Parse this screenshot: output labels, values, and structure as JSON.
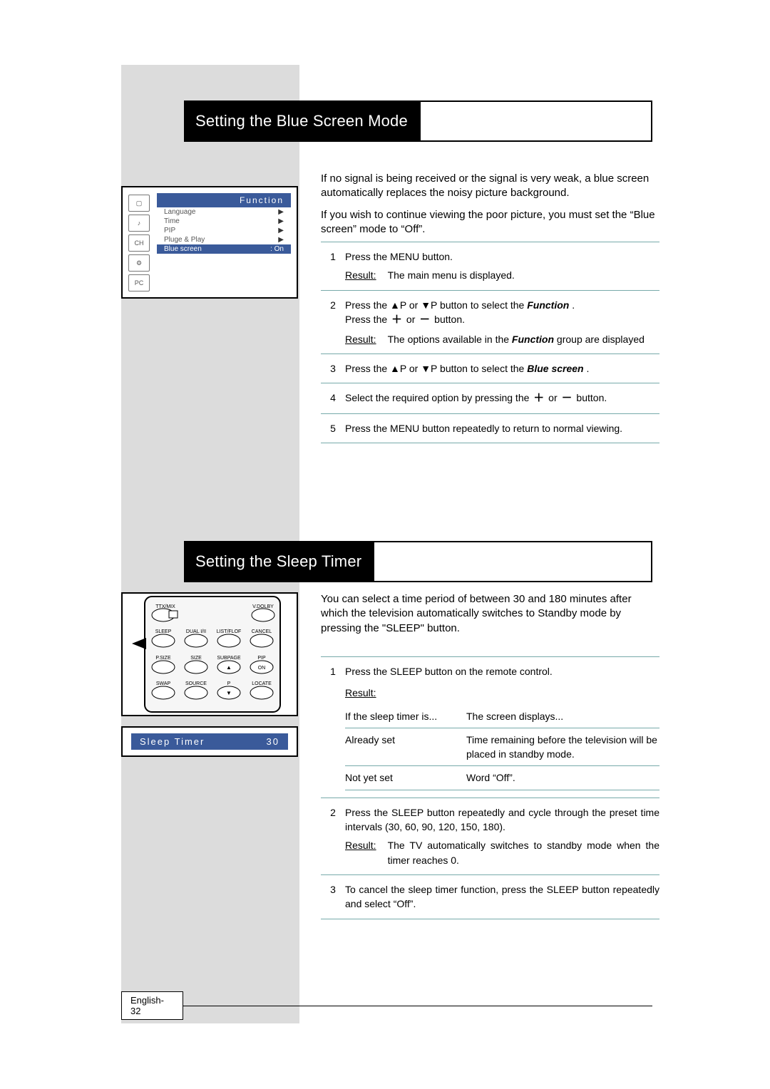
{
  "section1": {
    "title": "Setting the Blue Screen Mode",
    "intro1": "If no signal is being received or the signal is very weak, a blue screen automatically replaces the noisy picture background.",
    "intro2_a": "If you wish to continue viewing the poor picture, you must set the ",
    "intro2_b": "“Blue screen” mode to “Off”.",
    "osd": {
      "header": "Function",
      "items": [
        {
          "label": "Language",
          "val": "▶"
        },
        {
          "label": "Time",
          "val": "▶"
        },
        {
          "label": "PIP",
          "val": "▶"
        },
        {
          "label": "Pluge & Play",
          "val": "▶"
        }
      ],
      "sel_label": "Blue screen",
      "sel_val": ": On"
    },
    "steps": {
      "s1a": "Press the MENU button.",
      "s1_res": "The main menu is displayed.",
      "s2a": "Press the ▲P or ▼P button to select the ",
      "s2fn": "Function",
      "s2b": " .",
      "s2c": "Press the ",
      "s2d": " or ",
      "s2e": " button.",
      "s2_res_a": "The options available in the ",
      "s2_res_b": " group are displayed",
      "s3a": "Press the ▲P or ▼P button to select the ",
      "s3fn": "Blue screen",
      "s3b": " .",
      "s4a": "Select the required option by pressing the ",
      "s4b": " or ",
      "s4c": " button.",
      "s5": "Press the MENU button repeatedly to return to normal viewing."
    },
    "result_label": "Result:"
  },
  "section2": {
    "title": "Setting the Sleep Timer",
    "intro": "You can select a time period of between 30 and 180 minutes after which the television automatically switches to Standby mode by pressing the \"SLEEP\" button.",
    "sleep_osd_label": "Sleep Timer",
    "sleep_osd_val": "30",
    "remote_labels": {
      "ttxmix": "TTX/MIX",
      "vdolby": "V.DOLBY",
      "sleep": "SLEEP",
      "dual": "DUAL I/II",
      "listflof": "LIST/FLOF",
      "cancel": "CANCEL",
      "psize": "P.SIZE",
      "size": "SIZE",
      "subpage": "SUBPAGE",
      "pip": "PIP",
      "on": "ON",
      "swap": "SWAP",
      "source": "SOURCE",
      "p": "P",
      "locate": "LOCATE"
    },
    "steps": {
      "s1a": "Press the SLEEP button on the remote control.",
      "res_label": "Result:",
      "tbl_h1": "If the sleep timer is...",
      "tbl_h2": "The screen displays...",
      "r1c1": "Already set",
      "r1c2": "Time remaining before the television will be placed in standby mode.",
      "r2c1": "Not yet set",
      "r2c2": "Word “Off”.",
      "s2a": "Press the SLEEP button repeatedly and cycle through the preset time intervals (30, 60, 90, 120, 150, 180).",
      "s2_res": "The TV automatically switches to standby mode when the timer reaches 0.",
      "s3": "To cancel the sleep timer function, press the SLEEP button repeatedly and select “Off”."
    }
  },
  "footer": "English-32",
  "glyphs": {
    "plus": "＋",
    "minus": "－"
  }
}
